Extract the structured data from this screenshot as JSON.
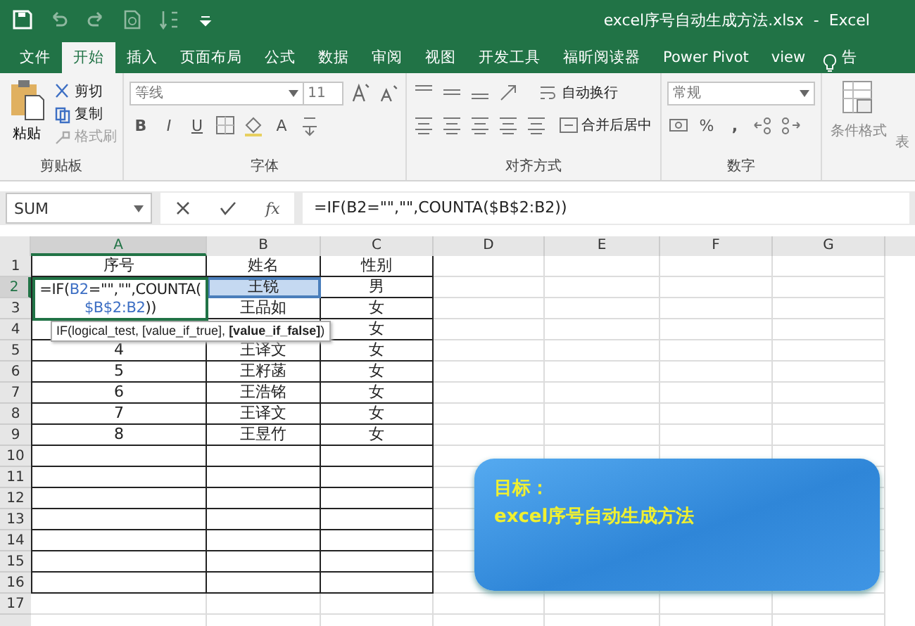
{
  "window": {
    "title": "excel序号自动生成方法.xlsx  -  Excel"
  },
  "ribbon_tabs": [
    {
      "label": "文件",
      "selected": false
    },
    {
      "label": "开始",
      "selected": true
    },
    {
      "label": "插入",
      "selected": false
    },
    {
      "label": "页面布局",
      "selected": false
    },
    {
      "label": "公式",
      "selected": false
    },
    {
      "label": "数据",
      "selected": false
    },
    {
      "label": "审阅",
      "selected": false
    },
    {
      "label": "视图",
      "selected": false
    },
    {
      "label": "开发工具",
      "selected": false
    },
    {
      "label": "福昕阅读器",
      "selected": false
    },
    {
      "label": "Power Pivot",
      "selected": false
    },
    {
      "label": "view",
      "selected": false
    },
    {
      "label": "告",
      "selected": false
    }
  ],
  "ribbon": {
    "clipboard": {
      "label": "剪贴板",
      "paste": "粘贴",
      "items": [
        {
          "label": "剪切",
          "disabled": false
        },
        {
          "label": "复制",
          "disabled": false
        },
        {
          "label": "格式刷",
          "disabled": true
        }
      ]
    },
    "font": {
      "label": "字体",
      "font_name": "等线",
      "font_size": "11",
      "styles": [
        "B",
        "I",
        "U"
      ],
      "font_color": "A"
    },
    "alignment": {
      "label": "对齐方式",
      "wrap_text": "自动换行",
      "merge_center": "合并后居中"
    },
    "number": {
      "label": "数字",
      "format": "常规",
      "percent": "%",
      "comma": ","
    },
    "styles": {
      "conditional_format": "条件格式",
      "cut_label": "表"
    }
  },
  "formula_bar": {
    "name_box": "SUM",
    "function_label": "fx",
    "formula": "=IF(B2=\"\",\"\",COUNTA($B$2:B2))"
  },
  "sheet": {
    "columns": [
      {
        "label": "A",
        "selected": true
      },
      {
        "label": "B",
        "selected": false
      },
      {
        "label": "C",
        "selected": false
      },
      {
        "label": "D",
        "selected": false
      },
      {
        "label": "E",
        "selected": false
      },
      {
        "label": "F",
        "selected": false
      },
      {
        "label": "G",
        "selected": false
      }
    ],
    "rows": [
      {
        "number": "1",
        "selected": false,
        "bordered": true,
        "cells": [
          {
            "text": "序号",
            "selected": false
          },
          {
            "text": "姓名",
            "selected": false
          },
          {
            "text": "性别",
            "selected": false
          }
        ]
      },
      {
        "number": "2",
        "selected": true,
        "bordered": true,
        "cells": [
          {
            "kind": "editor"
          },
          {
            "text": "王锐",
            "selected": true
          },
          {
            "text": "男",
            "selected": false
          }
        ]
      },
      {
        "number": "3",
        "selected": false,
        "bordered": true,
        "cells": [
          {},
          {
            "text": "王品如",
            "selected": false
          },
          {
            "text": "女",
            "selected": false
          }
        ]
      },
      {
        "number": "4",
        "selected": false,
        "bordered": true,
        "cells": [
          {
            "selected": false
          },
          {
            "selected": false
          },
          {
            "text": "女",
            "selected": false
          }
        ]
      },
      {
        "number": "5",
        "selected": false,
        "bordered": true,
        "cells": [
          {
            "text": "4",
            "selected": false
          },
          {
            "text": "王译文",
            "selected": false
          },
          {
            "text": "女",
            "selected": false
          }
        ]
      },
      {
        "number": "6",
        "selected": false,
        "bordered": true,
        "cells": [
          {
            "text": "5",
            "selected": false
          },
          {
            "text": "王籽菡",
            "selected": false
          },
          {
            "text": "女",
            "selected": false
          }
        ]
      },
      {
        "number": "7",
        "selected": false,
        "bordered": true,
        "cells": [
          {
            "text": "6",
            "selected": false
          },
          {
            "text": "王浩铭",
            "selected": false
          },
          {
            "text": "女",
            "selected": false
          }
        ]
      },
      {
        "number": "8",
        "selected": false,
        "bordered": true,
        "cells": [
          {
            "text": "7",
            "selected": false
          },
          {
            "text": "王译文",
            "selected": false
          },
          {
            "text": "女",
            "selected": false
          }
        ]
      },
      {
        "number": "9",
        "selected": false,
        "bordered": true,
        "cells": [
          {
            "text": "8",
            "selected": false
          },
          {
            "text": "王昱竹",
            "selected": false
          },
          {
            "text": "女",
            "selected": false
          }
        ]
      },
      {
        "number": "10",
        "selected": false,
        "bordered": true,
        "cells": [
          {
            "selected": false
          },
          {
            "selected": false
          },
          {
            "selected": false
          }
        ]
      },
      {
        "number": "11",
        "selected": false,
        "bordered": true,
        "cells": [
          {
            "selected": false
          },
          {
            "selected": false
          },
          {
            "selected": false
          }
        ]
      },
      {
        "number": "12",
        "selected": false,
        "bordered": true,
        "cells": [
          {
            "selected": false
          },
          {
            "selected": false
          },
          {
            "selected": false
          }
        ]
      },
      {
        "number": "13",
        "selected": false,
        "bordered": true,
        "cells": [
          {
            "selected": false
          },
          {
            "selected": false
          },
          {
            "selected": false
          }
        ]
      },
      {
        "number": "14",
        "selected": false,
        "bordered": true,
        "cells": [
          {
            "selected": false
          },
          {
            "selected": false
          },
          {
            "selected": false
          }
        ]
      },
      {
        "number": "15",
        "selected": false,
        "bordered": true,
        "cells": [
          {
            "selected": false
          },
          {
            "selected": false
          },
          {
            "selected": false
          }
        ]
      },
      {
        "number": "16",
        "selected": false,
        "bordered": true,
        "cells": [
          {
            "selected": false
          },
          {
            "selected": false
          },
          {
            "selected": false
          }
        ]
      },
      {
        "number": "17",
        "selected": false,
        "bordered": false,
        "cells": [
          {
            "selected": false
          },
          {
            "selected": false
          },
          {
            "selected": false
          }
        ]
      }
    ],
    "editor": {
      "lines": [
        [
          {
            "kind": "text",
            "text": "=IF("
          },
          {
            "kind": "ref",
            "text": "B2"
          },
          {
            "kind": "text",
            "text": "=\"\",\"\",COUNTA("
          }
        ],
        [
          {
            "kind": "ref",
            "text": "$B$2:B2"
          },
          {
            "kind": "text",
            "text": "))"
          }
        ]
      ]
    },
    "tooltip": "IF(logical_test, [value_if_true], **[value_if_false]**)"
  },
  "callout": {
    "title": "目标：",
    "text": "excel序号自动生成方法"
  }
}
